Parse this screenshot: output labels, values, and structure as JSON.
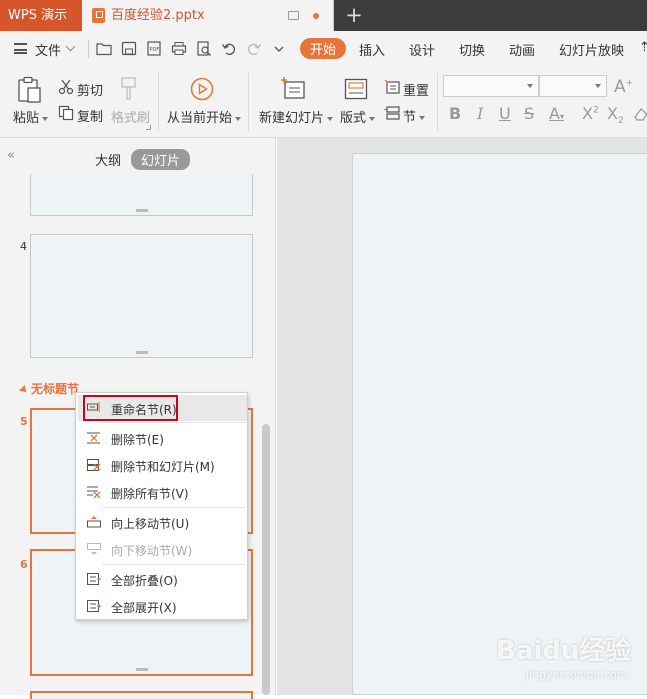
{
  "titlebar": {
    "app_name": "WPS 演示",
    "document_title": "百度经验2.pptx"
  },
  "menubar": {
    "file_label": "文件",
    "tabs": [
      {
        "label": "开始",
        "active": true
      },
      {
        "label": "插入"
      },
      {
        "label": "设计"
      },
      {
        "label": "切换"
      },
      {
        "label": "动画"
      },
      {
        "label": "幻灯片放映"
      }
    ]
  },
  "ribbon": {
    "paste": "粘贴",
    "cut": "剪切",
    "copy": "复制",
    "format_painter": "格式刷",
    "play_from_current": "从当前开始",
    "new_slide": "新建幻灯片",
    "layout": "版式",
    "reset": "重置",
    "section": "节"
  },
  "leftpanel": {
    "view_outline": "大纲",
    "view_slides": "幻灯片",
    "slide_numbers": [
      "4",
      "5",
      "6"
    ],
    "section_title": "无标题节"
  },
  "context_menu": {
    "items": [
      {
        "label": "重命名节(R)",
        "icon": "rename-section-icon"
      },
      {
        "label": "删除节(E)",
        "icon": "delete-section-icon"
      },
      {
        "label": "删除节和幻灯片(M)",
        "icon": "delete-section-slides-icon"
      },
      {
        "label": "删除所有节(V)",
        "icon": "delete-all-sections-icon"
      },
      {
        "label": "向上移动节(U)",
        "icon": "move-section-up-icon"
      },
      {
        "label": "向下移动节(W)",
        "icon": "move-section-down-icon",
        "disabled": true
      },
      {
        "label": "全部折叠(O)",
        "icon": "collapse-all-icon"
      },
      {
        "label": "全部展开(X)",
        "icon": "expand-all-icon"
      }
    ]
  },
  "watermark": {
    "text": "Baidu经验",
    "subtext": "jingyan.baidu.com"
  },
  "colors": {
    "accent": "#e8743b",
    "app_tab": "#d6552a",
    "highlight": "#d0021b"
  }
}
